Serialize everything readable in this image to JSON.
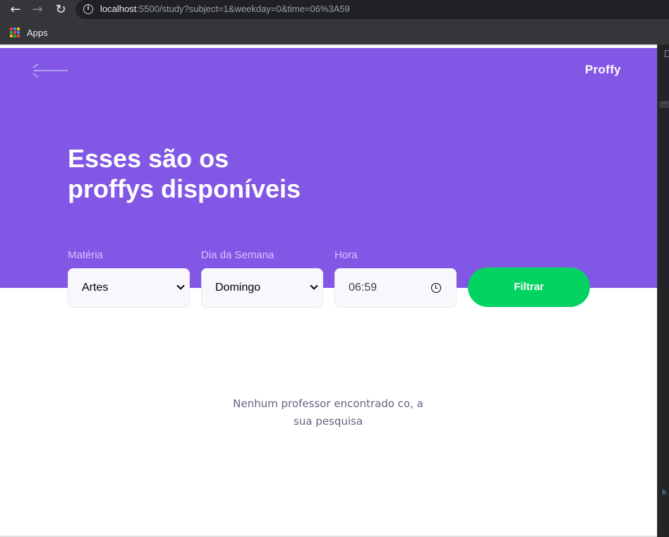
{
  "browser": {
    "url_host": "localhost",
    "url_rest": ":5500/study?subject=1&weekday=0&time=06%3A59",
    "bookmarks": {
      "apps_label": "Apps"
    },
    "icons": {
      "back": "arrow-left-icon",
      "forward": "arrow-right-icon",
      "reload": "reload-icon",
      "info": "info-icon"
    }
  },
  "header": {
    "logo": "Proffy",
    "back_icon": "arrow-left-icon"
  },
  "page": {
    "title_line1": "Esses são os",
    "title_line2": "proffys disponíveis"
  },
  "filters": {
    "subject": {
      "label": "Matéria",
      "value": "Artes"
    },
    "weekday": {
      "label": "Dia da Semana",
      "value": "Domingo"
    },
    "time": {
      "label": "Hora",
      "value": "06:59"
    },
    "submit_label": "Filtrar"
  },
  "results": {
    "empty_line1": "Nenhum professor encontrado co, a",
    "empty_line2": "sua pesquisa"
  },
  "colors": {
    "primary": "#8257e5",
    "button": "#04d361",
    "label": "#d4c2ff",
    "text_muted": "#6a6180",
    "input_bg": "#f8f8fc"
  }
}
